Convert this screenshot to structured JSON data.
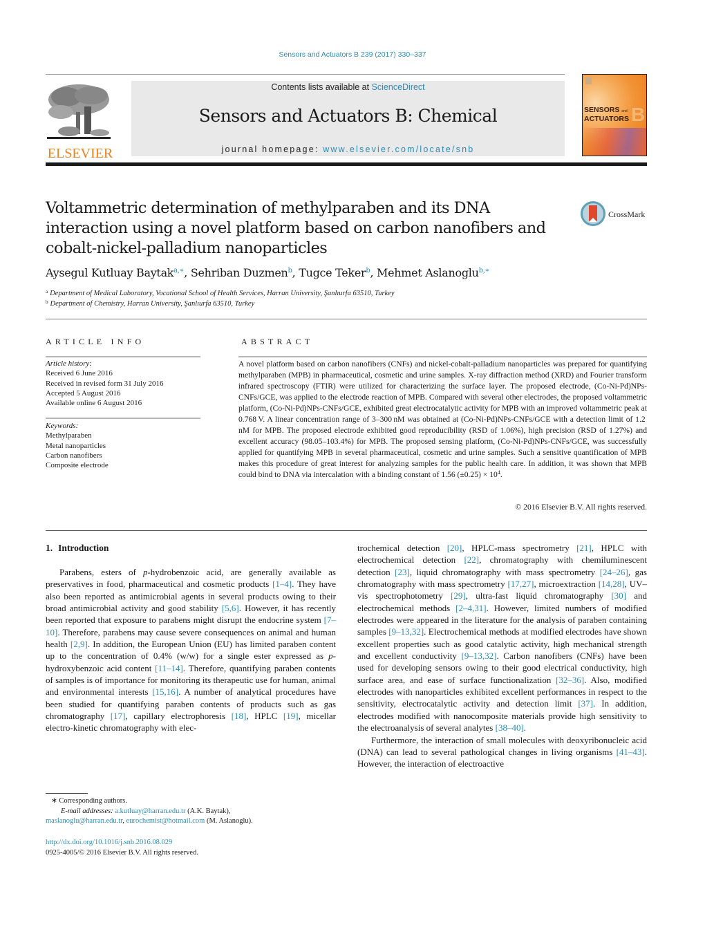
{
  "running_header": "Sensors and Actuators B 239 (2017) 330–337",
  "masthead": {
    "publisher_logo_text": "ELSEVIER",
    "contents_prefix": "Contents lists available at ",
    "contents_link": "ScienceDirect",
    "journal_name": "Sensors and Actuators B: Chemical",
    "homepage_prefix": "journal homepage: ",
    "homepage_link": "www.elsevier.com/locate/snb",
    "cover": {
      "line1": "SENSORS",
      "and": "and",
      "line2": "ACTUATORS",
      "letter": "B"
    },
    "colors": {
      "elsevier_orange": "#f07f1a",
      "link_blue": "#2a8bb5",
      "masthead_grey": "#e9e9e9"
    }
  },
  "article": {
    "title": "Voltammetric determination of methylparaben and its DNA interaction using a novel platform based on carbon nanofibers and cobalt-nickel-palladium nanoparticles",
    "title_lines": [
      "Voltammetric determination of methylparaben and its DNA",
      "interaction using a novel platform based on carbon nanofibers and",
      "cobalt-nickel-palladium nanoparticles"
    ],
    "crossmark_label": "CrossMark",
    "authors": [
      {
        "name": "Aysegul Kutluay Baytak",
        "marks": "a,∗"
      },
      {
        "name": "Sehriban Duzmen",
        "marks": "b"
      },
      {
        "name": "Tugce Teker",
        "marks": "b"
      },
      {
        "name": "Mehmet Aslanoglu",
        "marks": "b,∗"
      }
    ],
    "affiliations": [
      {
        "mark": "a",
        "text": "Department of Medical Laboratory, Vocational School of Health Services, Harran University, Şanlıurfa 63510, Turkey"
      },
      {
        "mark": "b",
        "text": "Department of Chemistry, Harran University, Şanlıurfa 63510, Turkey"
      }
    ]
  },
  "article_info": {
    "heading": "ARTICLE INFO",
    "history_label": "Article history:",
    "history": [
      "Received 6 June 2016",
      "Received in revised form 31 July 2016",
      "Accepted 5 August 2016",
      "Available online 6 August 2016"
    ],
    "keywords_label": "Keywords:",
    "keywords": [
      "Methylparaben",
      "Metal nanoparticles",
      "Carbon nanofibers",
      "Composite electrode"
    ]
  },
  "abstract": {
    "heading": "ABSTRACT",
    "text": "A novel platform based on carbon nanofibers (CNFs) and nickel-cobalt-palladium nanoparticles was prepared for quantifying methylparaben (MPB) in pharmaceutical, cosmetic and urine samples. X-ray diffraction method (XRD) and Fourier transform infrared spectroscopy (FTIR) were utilized for characterizing the surface layer. The proposed electrode, (Co-Ni-Pd)NPs-CNFs/GCE, was applied to the electrode reaction of MPB. Compared with several other electrodes, the proposed voltammetric platform, (Co-Ni-Pd)NPs-CNFs/GCE, exhibited great electrocatalytic activity for MPB with an improved voltammetric peak at 0.768 V. A linear concentration range of 3–300 nM was obtained at (Co-Ni-Pd)NPs-CNFs/GCE with a detection limit of 1.2 nM for MPB. The proposed electrode exhibited good reproducibility (RSD of 1.06%), high precision (RSD of 1.27%) and excellent accuracy (98.05–103.4%) for MPB. The proposed sensing platform, (Co-Ni-Pd)NPs-CNFs/GCE, was successfully applied for quantifying MPB in several pharmaceutical, cosmetic and urine samples. Such a sensitive quantification of MPB makes this procedure of great interest for analyzing samples for the public health care. In addition, it was shown that MPB could bind to DNA via intercalation with a binding constant of 1.56 (±0.25) × 10",
    "exponent": "4",
    "end": ".",
    "copyright": "© 2016 Elsevier B.V. All rights reserved."
  },
  "introduction": {
    "number": "1.",
    "heading": "Introduction",
    "left_column": [
      [
        {
          "t": "Parabens, esters of "
        },
        {
          "t": "p",
          "i": true
        },
        {
          "t": "-hydrobenzoic acid, are generally available as preservatives in food, pharmaceutical and cosmetic products "
        },
        {
          "r": "[1–4]"
        },
        {
          "t": ". They have also been reported as antimicrobial agents in several products owing to their broad antimicrobial activity and good stability "
        },
        {
          "r": "[5,6]"
        },
        {
          "t": ". However, it has recently been reported that exposure to parabens might disrupt the endocrine system "
        },
        {
          "r": "[7–10]"
        },
        {
          "t": ". Therefore, parabens may cause severe consequences on animal and human health "
        },
        {
          "r": "[2,9]"
        },
        {
          "t": ". In addition, the European Union (EU) has limited paraben content up to the concentration of 0.4% (w/w) for a single ester expressed as "
        },
        {
          "t": "p",
          "i": true
        },
        {
          "t": "-hydroxybenzoic acid content "
        },
        {
          "r": "[11–14]"
        },
        {
          "t": ". Therefore, quantifying paraben contents of samples is of importance for monitoring its therapeutic use for human, animal and environmental interests "
        },
        {
          "r": "[15,16]"
        },
        {
          "t": ". A number of analytical procedures have been studied for quantifying paraben contents of products such as gas chromatography "
        },
        {
          "r": "[17]"
        },
        {
          "t": ", capillary electrophoresis "
        },
        {
          "r": "[18]"
        },
        {
          "t": ", HPLC "
        },
        {
          "r": "[19]"
        },
        {
          "t": ", micellar electro-kinetic chromatography with elec-"
        }
      ]
    ],
    "right_column": [
      [
        {
          "t": "trochemical detection "
        },
        {
          "r": "[20]"
        },
        {
          "t": ", HPLC-mass spectrometry "
        },
        {
          "r": "[21]"
        },
        {
          "t": ", HPLC with electrochemical detection "
        },
        {
          "r": "[22]"
        },
        {
          "t": ", chromatography with chemiluminescent detection "
        },
        {
          "r": "[23]"
        },
        {
          "t": ", liquid chromatography with mass spectrometry "
        },
        {
          "r": "[24–26]"
        },
        {
          "t": ", gas chromatography with mass spectrometry "
        },
        {
          "r": "[17,27]"
        },
        {
          "t": ", microextraction "
        },
        {
          "r": "[14,28]"
        },
        {
          "t": ", UV–vis spectrophotometry "
        },
        {
          "r": "[29]"
        },
        {
          "t": ", ultra-fast liquid chromatography "
        },
        {
          "r": "[30]"
        },
        {
          "t": " and electrochemical methods "
        },
        {
          "r": "[2–4,31]"
        },
        {
          "t": ". However, limited numbers of modified electrodes were appeared in the literature for the analysis of paraben containing samples "
        },
        {
          "r": "[9–13,32]"
        },
        {
          "t": ". Electrochemical methods at modified electrodes have shown excellent properties such as good catalytic activity, high mechanical strength and excellent conductivity "
        },
        {
          "r": "[9–13,32]"
        },
        {
          "t": ". Carbon nanofibers (CNFs) have been used for developing sensors owing to their good electrical conductivity, high surface area, and ease of surface functionalization "
        },
        {
          "r": "[32–36]"
        },
        {
          "t": ". Also, modified electrodes with nanoparticles exhibited excellent performances in respect to the sensitivity, electrocatalytic activity and detection limit "
        },
        {
          "r": "[37]"
        },
        {
          "t": ". In addition, electrodes modified with nanocomposite materials provide high sensitivity to the electroanalysis of several analytes "
        },
        {
          "r": "[38–40]"
        },
        {
          "t": "."
        }
      ],
      [
        {
          "t": "Furthermore, the interaction of small molecules with deoxyribonucleic acid (DNA) can lead to several pathological changes in living organisms "
        },
        {
          "r": "[41–43]"
        },
        {
          "t": ". However, the interaction of electroactive"
        }
      ]
    ]
  },
  "footnotes": {
    "corresponding": "∗ Corresponding authors.",
    "email_label": "E-mail addresses:",
    "email1": "a.kutluay@harran.edu.tr",
    "email1_owner": " (A.K. Baytak),",
    "email2": "maslanoglu@harran.edu.tr",
    "email3": "eurochemist@hotmail.com",
    "email23_owner": " (M. Aslanoglu).",
    "doi": "http://dx.doi.org/10.1016/j.snb.2016.08.029",
    "issn_line": "0925-4005/© 2016 Elsevier B.V. All rights reserved."
  }
}
